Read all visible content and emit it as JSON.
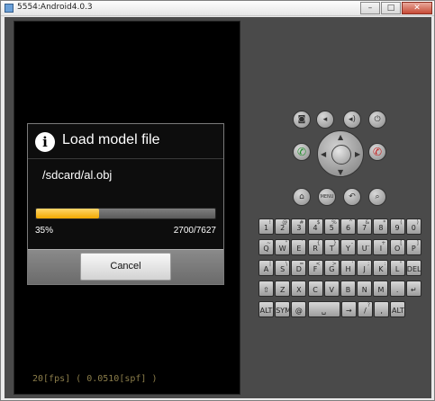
{
  "window": {
    "title": "5554:Android4.0.3",
    "controls": {
      "minimize": "–",
      "maximize": "□",
      "close": "✕"
    }
  },
  "dialog": {
    "title": "Load model file",
    "message": "/sdcard/al.obj",
    "progress_fraction": 0.35,
    "progress_percent": "35%",
    "progress_count": "2700/7627",
    "cancel_label": "Cancel",
    "accent_color": "#f1a800"
  },
  "fps": "20[fps] ( 0.0510[spf] )",
  "controls": {
    "buttons": [
      {
        "name": "camera-icon",
        "glyph": "◙"
      },
      {
        "name": "volume-down-icon",
        "glyph": "◂"
      },
      {
        "name": "volume-up-icon",
        "glyph": "◂)"
      },
      {
        "name": "power-icon",
        "glyph": "⏻"
      }
    ],
    "call_glyph": "✆",
    "end_call_glyph": "✆",
    "home_glyph": "⌂",
    "menu_label": "MENU",
    "back_glyph": "↶",
    "search_glyph": "⌕"
  },
  "keyboard": {
    "row1": [
      {
        "k": "1",
        "s": "!"
      },
      {
        "k": "2",
        "s": "@"
      },
      {
        "k": "3",
        "s": "#"
      },
      {
        "k": "4",
        "s": "$"
      },
      {
        "k": "5",
        "s": "%"
      },
      {
        "k": "6",
        "s": "^"
      },
      {
        "k": "7",
        "s": "&"
      },
      {
        "k": "8",
        "s": "*"
      },
      {
        "k": "9",
        "s": "("
      },
      {
        "k": "0",
        "s": ")"
      }
    ],
    "row2": [
      {
        "k": "Q",
        "s": "~"
      },
      {
        "k": "W",
        "s": "\""
      },
      {
        "k": "E",
        "s": "`"
      },
      {
        "k": "R",
        "s": "{"
      },
      {
        "k": "T",
        "s": "}"
      },
      {
        "k": "Y",
        "s": "-"
      },
      {
        "k": "U",
        "s": "_"
      },
      {
        "k": "I",
        "s": "+"
      },
      {
        "k": "O",
        "s": "["
      },
      {
        "k": "P",
        "s": "]"
      }
    ],
    "row3": [
      {
        "k": "A",
        "s": "|"
      },
      {
        "k": "S",
        "s": "\\"
      },
      {
        "k": "D",
        "s": "="
      },
      {
        "k": "F",
        "s": "<"
      },
      {
        "k": "G",
        "s": ">"
      },
      {
        "k": "H",
        "s": "'"
      },
      {
        "k": "J",
        "s": ";"
      },
      {
        "k": "K",
        "s": ":"
      },
      {
        "k": "L",
        "s": "\""
      },
      {
        "k": "DEL",
        "s": ""
      }
    ],
    "row4": [
      {
        "k": "⇧",
        "s": ""
      },
      {
        "k": "Z",
        "s": ""
      },
      {
        "k": "X",
        "s": ""
      },
      {
        "k": "C",
        "s": ""
      },
      {
        "k": "V",
        "s": ""
      },
      {
        "k": "B",
        "s": ""
      },
      {
        "k": "N",
        "s": ""
      },
      {
        "k": "M",
        "s": ""
      },
      {
        "k": ".",
        "s": ""
      },
      {
        "k": "↵",
        "s": ""
      }
    ],
    "row5": [
      {
        "k": "ALT",
        "s": ""
      },
      {
        "k": "SYM",
        "s": ""
      },
      {
        "k": "@",
        "s": ""
      },
      {
        "k": "␣",
        "s": ""
      },
      {
        "k": "→",
        "s": ""
      },
      {
        "k": "/",
        "s": "?"
      },
      {
        "k": ",",
        "s": ""
      },
      {
        "k": "ALT",
        "s": ""
      }
    ]
  }
}
